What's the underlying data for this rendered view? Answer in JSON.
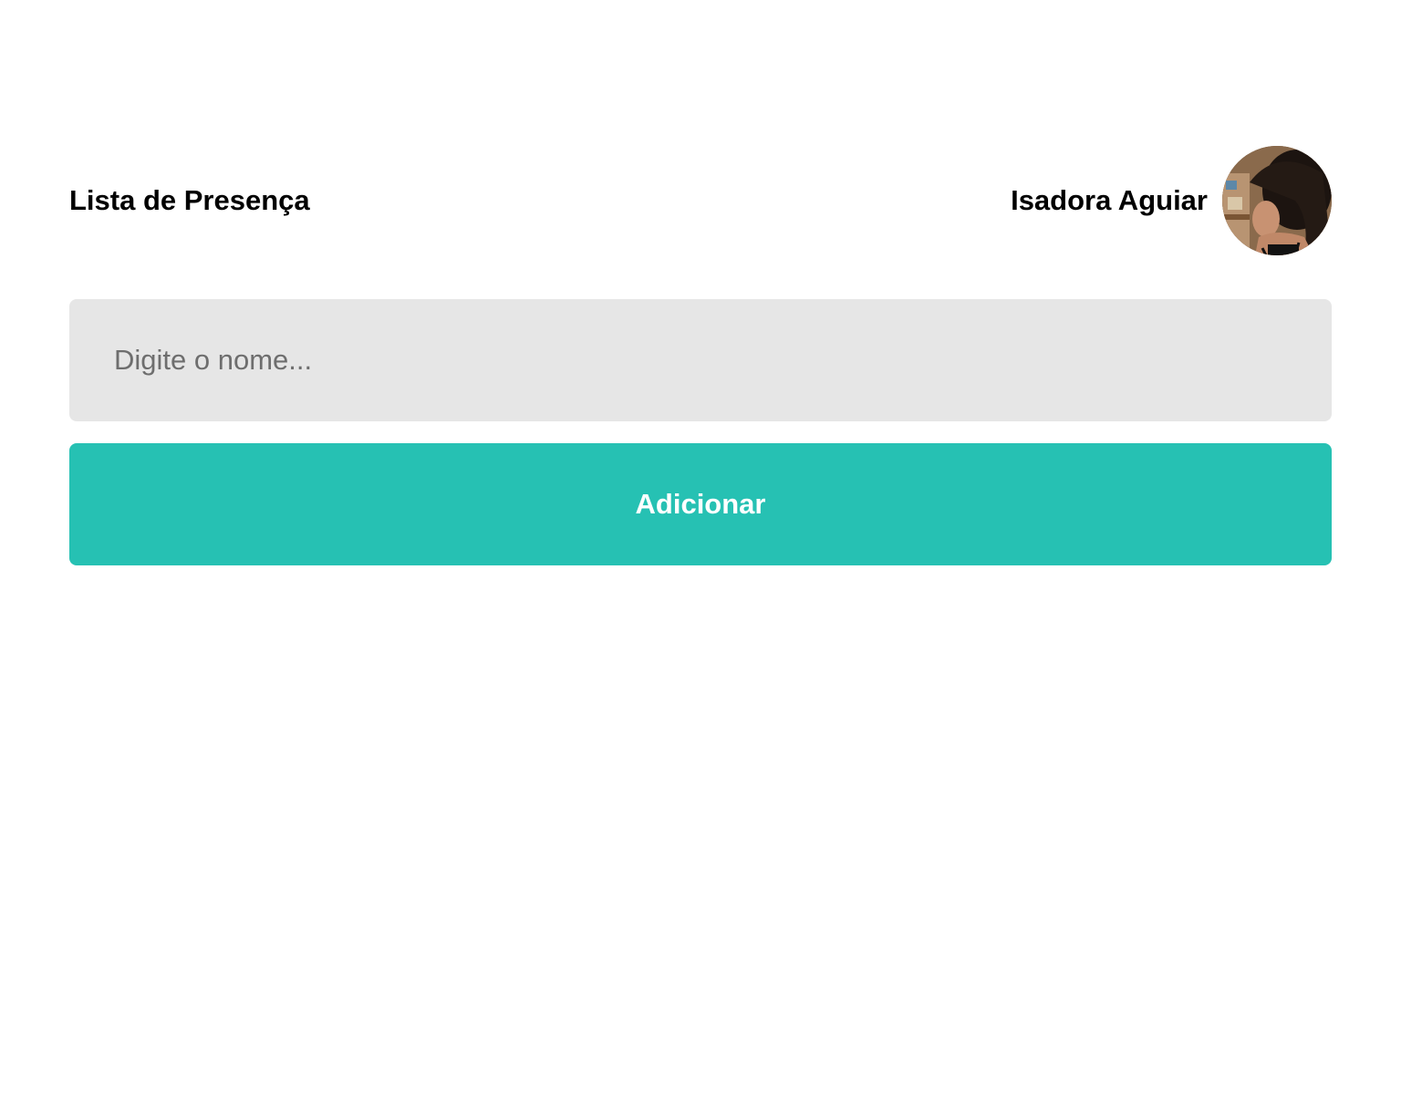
{
  "header": {
    "title": "Lista de Presença",
    "user": {
      "name": "Isadora Aguiar",
      "avatar_icon": "user-avatar-photo"
    }
  },
  "form": {
    "name_input": {
      "value": "",
      "placeholder": "Digite o nome..."
    },
    "add_button_label": "Adicionar"
  },
  "colors": {
    "accent": "#26c1b3",
    "input_background": "#e6e6e6",
    "text": "#000000",
    "placeholder": "#6e6e6e"
  }
}
